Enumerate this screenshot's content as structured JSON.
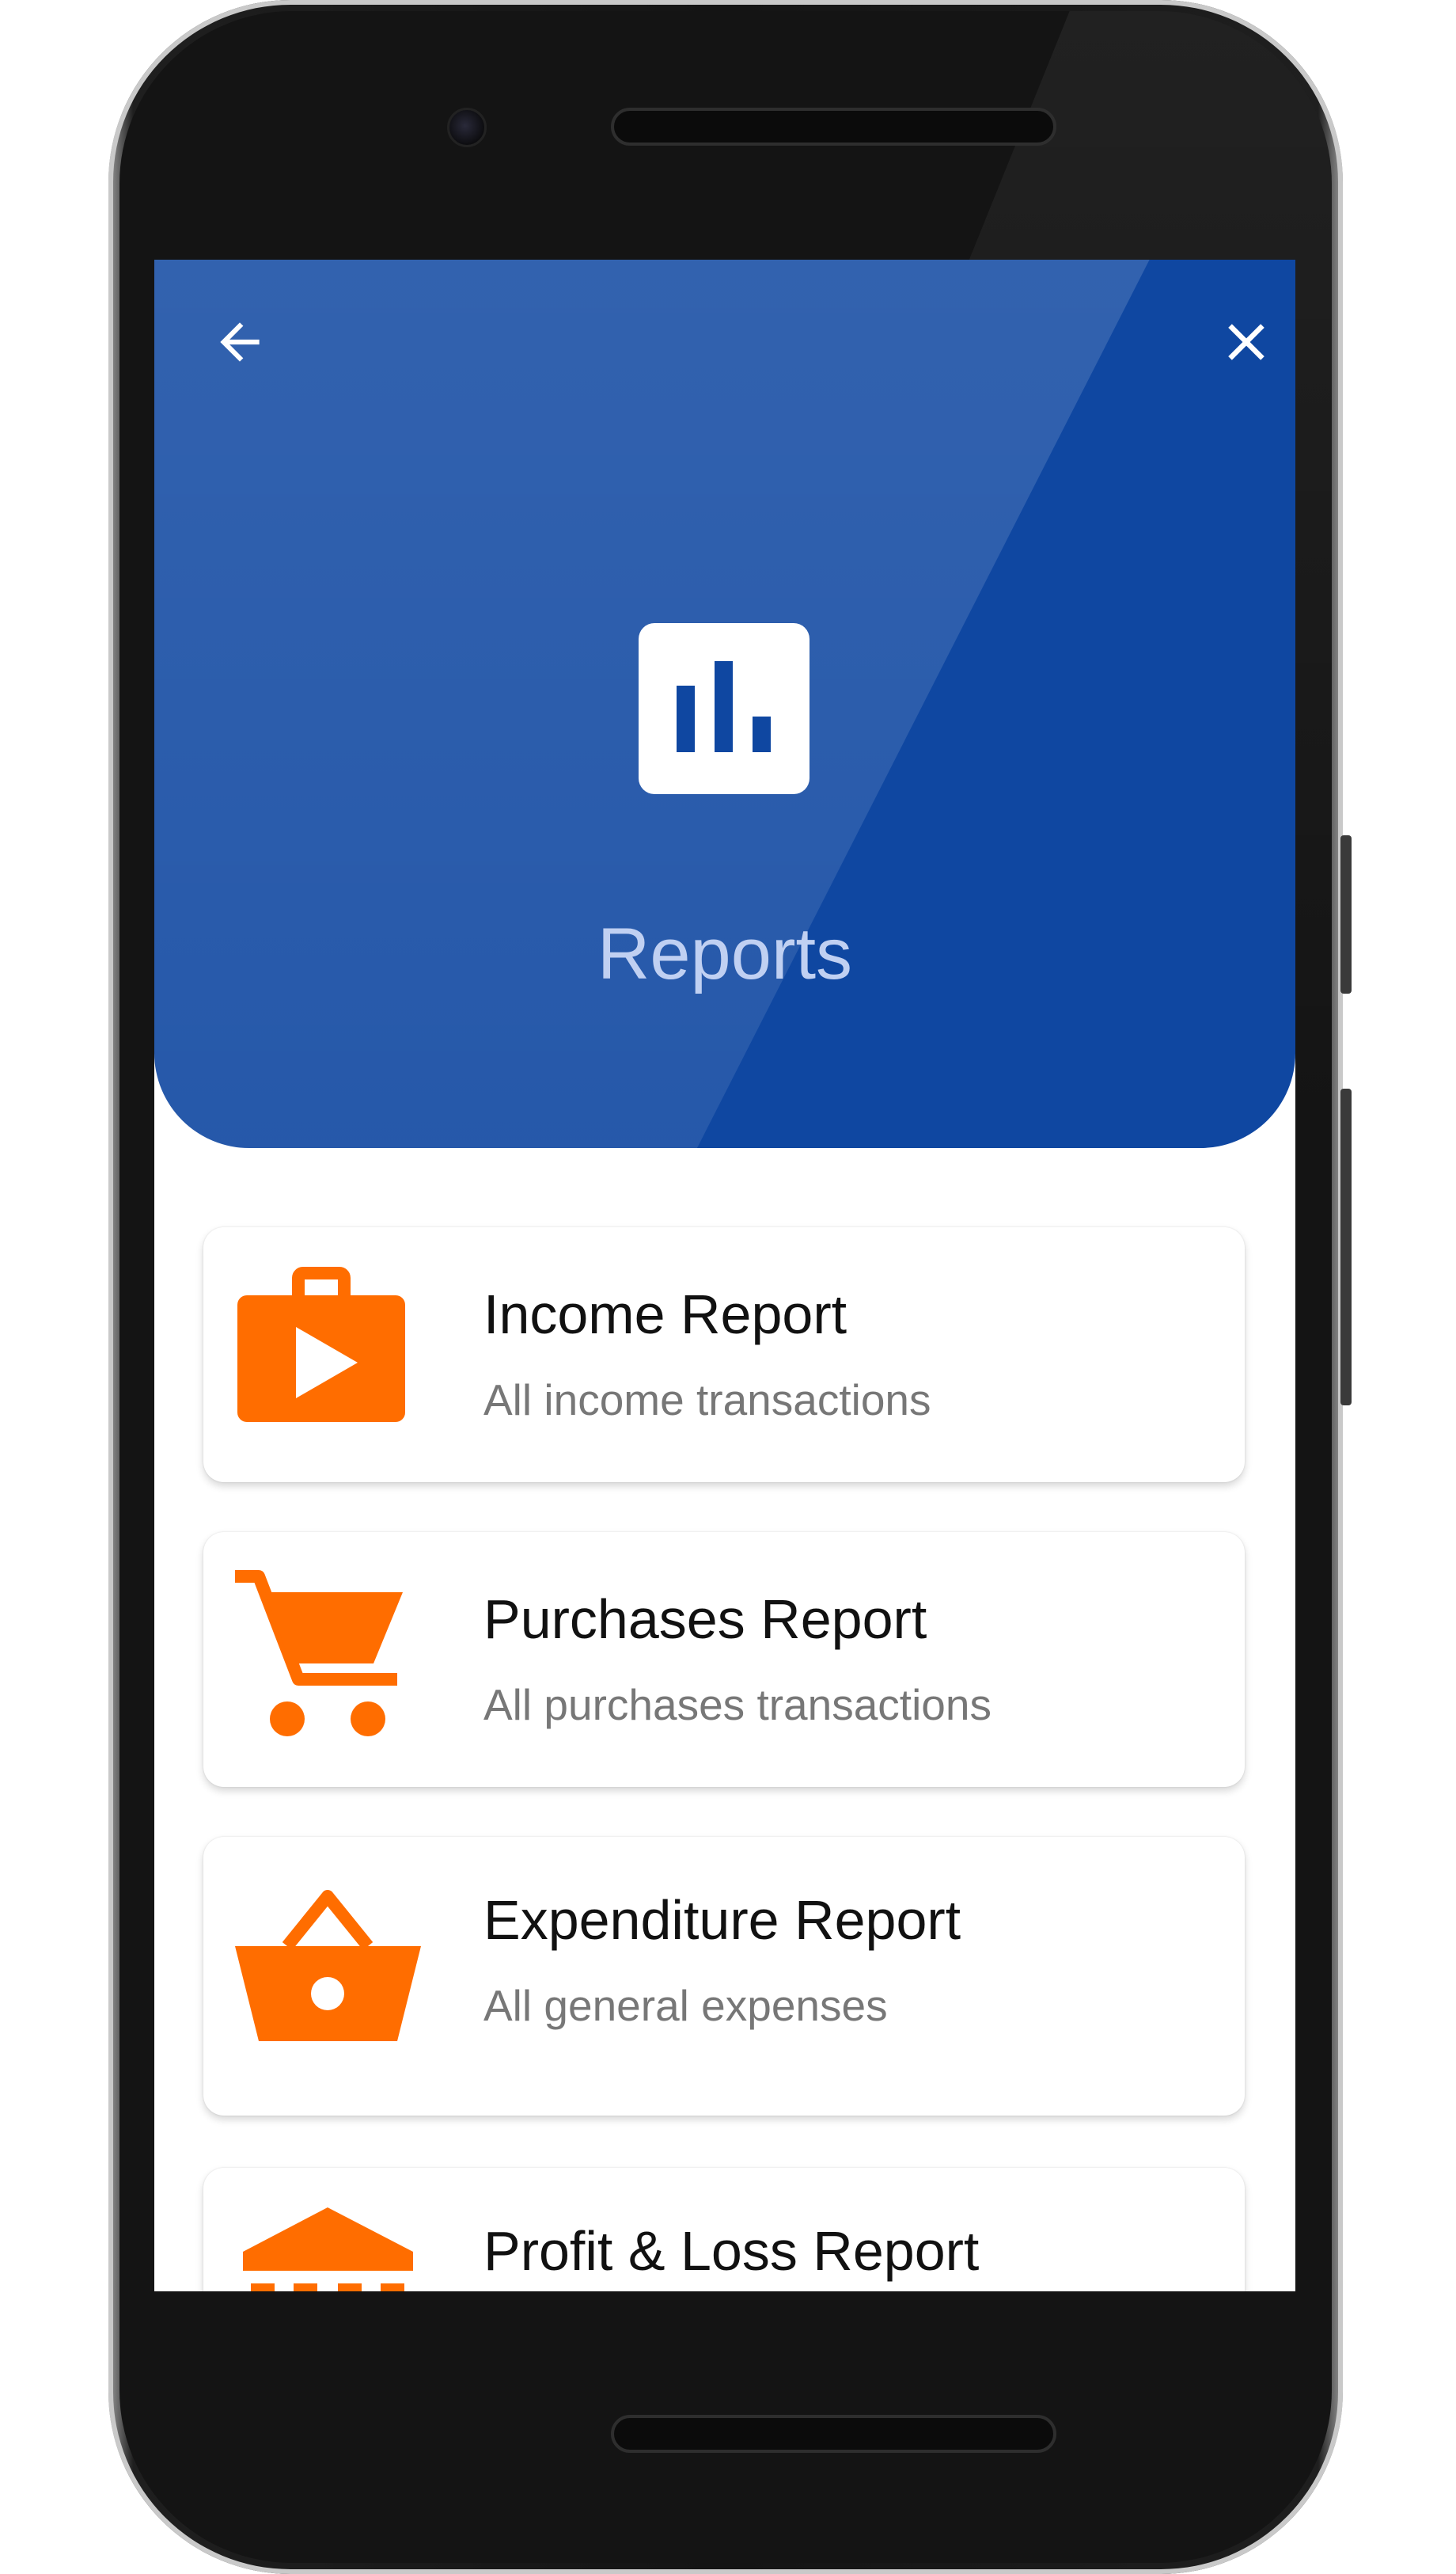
{
  "header": {
    "title": "Reports",
    "back_icon": "arrow-left-icon",
    "close_icon": "close-icon",
    "report_icon": "bar-chart-icon",
    "background_color": "#0f47a1"
  },
  "reports": [
    {
      "title": "Income Report",
      "subtitle": "All income transactions",
      "icon": "briefcase-play-icon"
    },
    {
      "title": "Purchases Report",
      "subtitle": "All purchases transactions",
      "icon": "shopping-cart-icon"
    },
    {
      "title": "Expenditure Report",
      "subtitle": "All general expenses",
      "icon": "shopping-basket-icon"
    },
    {
      "title": "Profit & Loss Report",
      "icon": "bank-icon"
    }
  ],
  "colors": {
    "accent": "#ff6d00",
    "title_text": "#111111",
    "subtitle_text": "#777777"
  }
}
